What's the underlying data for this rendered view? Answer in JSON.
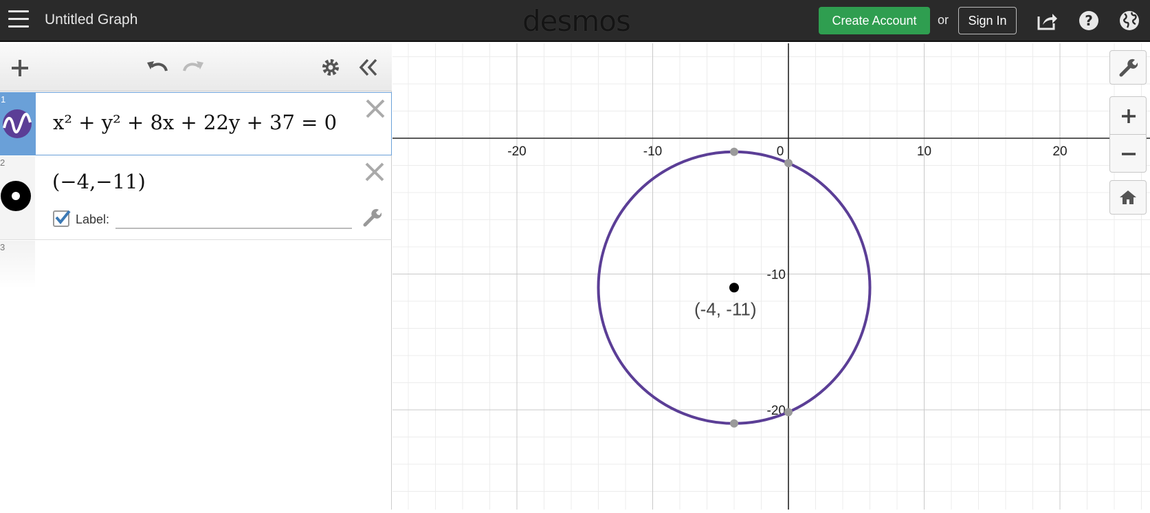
{
  "header": {
    "menu_icon": "hamburger-menu-icon",
    "title": "Untitled Graph",
    "logo": "desmos",
    "create_account": "Create Account",
    "or": "or",
    "sign_in": "Sign In",
    "icons": [
      "share-icon",
      "help-icon",
      "globe-icon"
    ]
  },
  "toolbar": {
    "icons": [
      "add-icon",
      "undo-icon",
      "redo-icon",
      "settings-gear-icon",
      "collapse-double-chevron-icon"
    ]
  },
  "expressions": [
    {
      "index": "1",
      "latex": "x² + y² + 8x + 22y + 37 = 0",
      "color": "#5b3e96",
      "icon": "function-wave-icon"
    },
    {
      "index": "2",
      "latex": "(−4,−11)",
      "color": "#000000",
      "icon": "point-icon",
      "label_checkbox": "Label:",
      "label_checked": true
    },
    {
      "index": "3",
      "latex": ""
    }
  ],
  "graph": {
    "x_ticks": [
      "-20",
      "-10",
      "0",
      "10",
      "20"
    ],
    "y_ticks": [
      "-10",
      "-20"
    ],
    "point_label": "(-4, -11)",
    "curve_color": "#5b3e96",
    "right_tools": [
      "wrench-icon",
      "zoom-in-icon",
      "zoom-out-icon",
      "home-icon"
    ]
  },
  "chart_data": {
    "type": "scatter",
    "x_range": [
      -29,
      31
    ],
    "y_range": [
      -27.5,
      7
    ],
    "circle": {
      "center_x": -4,
      "center_y": -11,
      "radius": 10
    },
    "points": [
      {
        "x": -4,
        "y": -11,
        "label": "(-4, -11)",
        "color": "#000000"
      },
      {
        "x": -4,
        "y": -1,
        "color": "#9a9a9a"
      },
      {
        "x": -4,
        "y": -21,
        "color": "#9a9a9a"
      },
      {
        "x": 0,
        "y": -1.83,
        "color": "#9a9a9a"
      },
      {
        "x": 0,
        "y": -20.17,
        "color": "#9a9a9a"
      }
    ],
    "grid": true
  }
}
